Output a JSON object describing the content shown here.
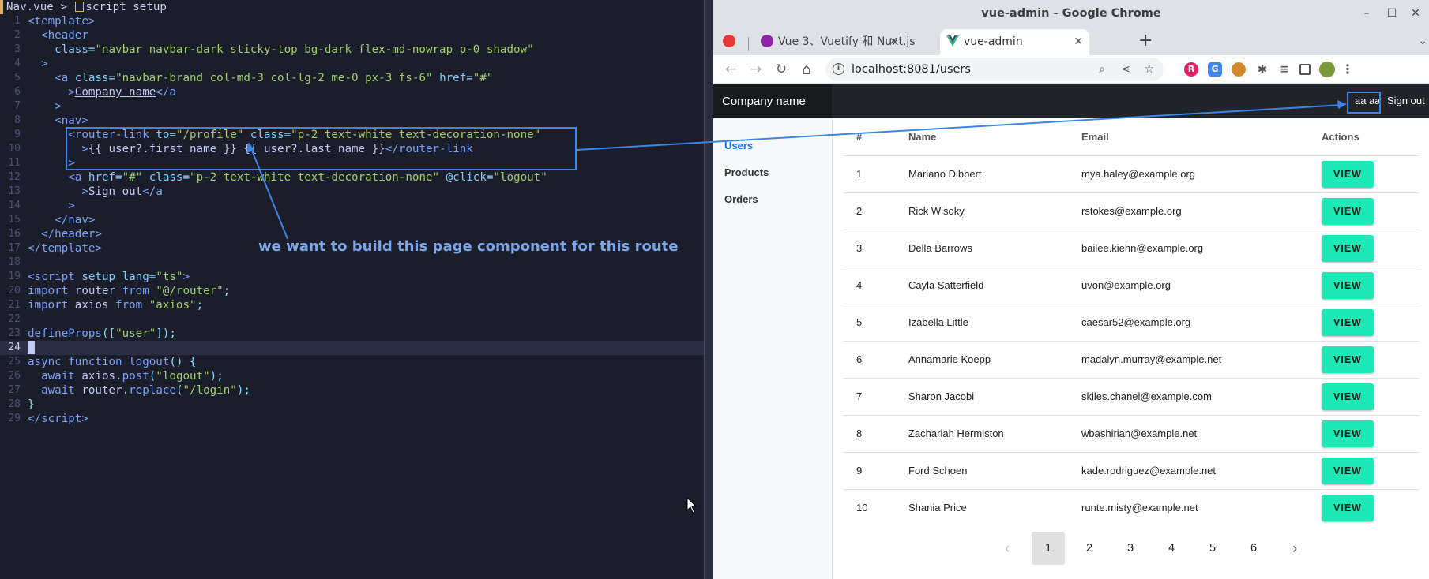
{
  "editor": {
    "breadcrumb_file": "Nav.vue",
    "breadcrumb_sep": " > ",
    "breadcrumb_scope": "script setup",
    "line_numbers": [
      "1",
      "2",
      "3",
      "4",
      "5",
      "6",
      "7",
      "8",
      "9",
      "10",
      "11",
      "12",
      "13",
      "14",
      "15",
      "16",
      "17",
      "18",
      "19",
      "20",
      "21",
      "22",
      "23",
      "24",
      "25",
      "26",
      "27",
      "28",
      "29"
    ],
    "annotation_caption": "we want to build this page component for this route"
  },
  "browser": {
    "window_title": "vue-admin - Google Chrome",
    "minimize": "–",
    "maximize": "☐",
    "close": "✕",
    "tabs": [
      {
        "label": "Vue 3、Vuetify 和 Nuxt.js",
        "close": "✕"
      },
      {
        "label": "vue-admin",
        "close": "✕"
      }
    ],
    "new_tab": "+",
    "tab_menu": "⌄",
    "url": "localhost:8081/users",
    "nav": {
      "back": "←",
      "forward": "→",
      "reload": "↻",
      "home": "⌂"
    }
  },
  "app": {
    "brand": "Company name",
    "user_name": "aa aa",
    "signout": "Sign out",
    "sidebar": [
      {
        "label": "Users",
        "active": true
      },
      {
        "label": "Products",
        "active": false
      },
      {
        "label": "Orders",
        "active": false
      }
    ],
    "table": {
      "headers": [
        "#",
        "Name",
        "Email",
        "Actions"
      ],
      "view_label": "VIEW",
      "rows": [
        {
          "id": "1",
          "name": "Mariano Dibbert",
          "email": "mya.haley@example.org"
        },
        {
          "id": "2",
          "name": "Rick Wisoky",
          "email": "rstokes@example.org"
        },
        {
          "id": "3",
          "name": "Della Barrows",
          "email": "bailee.kiehn@example.org"
        },
        {
          "id": "4",
          "name": "Cayla Satterfield",
          "email": "uvon@example.org"
        },
        {
          "id": "5",
          "name": "Izabella Little",
          "email": "caesar52@example.org"
        },
        {
          "id": "6",
          "name": "Annamarie Koepp",
          "email": "madalyn.murray@example.net"
        },
        {
          "id": "7",
          "name": "Sharon Jacobi",
          "email": "skiles.chanel@example.com"
        },
        {
          "id": "8",
          "name": "Zachariah Hermiston",
          "email": "wbashirian@example.net"
        },
        {
          "id": "9",
          "name": "Ford Schoen",
          "email": "kade.rodriguez@example.net"
        },
        {
          "id": "10",
          "name": "Shania Price",
          "email": "runte.misty@example.net"
        }
      ]
    },
    "pagination": {
      "prev": "‹",
      "next": "›",
      "pages": [
        "1",
        "2",
        "3",
        "4",
        "5",
        "6"
      ],
      "current": "1"
    }
  },
  "colors": {
    "annotation": "#3b86e5",
    "view_button": "#1de9b6",
    "navbar": "#212529",
    "editor_bg": "#1b1d2b"
  }
}
